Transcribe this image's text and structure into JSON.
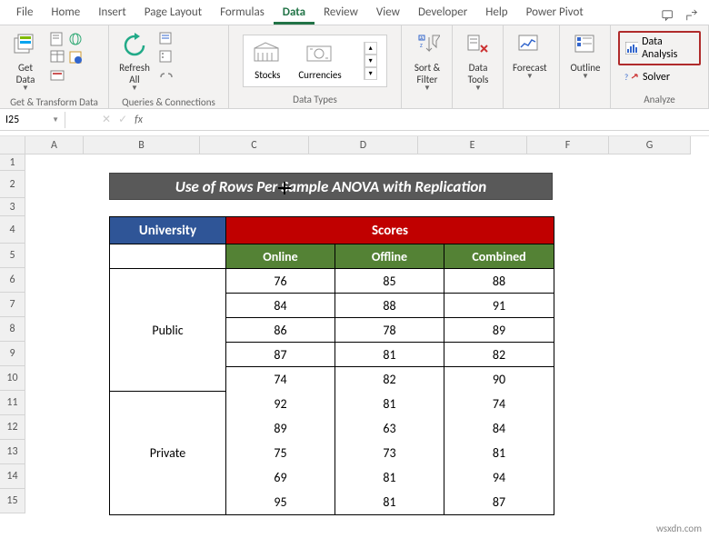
{
  "tabs": [
    "File",
    "Home",
    "Insert",
    "Page Layout",
    "Formulas",
    "Data",
    "Review",
    "View",
    "Developer",
    "Help",
    "Power Pivot"
  ],
  "active_tab": "Data",
  "ribbon": {
    "get_transform": {
      "get_data": "Get\nData",
      "label": "Get & Transform Data"
    },
    "queries": {
      "refresh": "Refresh\nAll",
      "label": "Queries & Connections"
    },
    "data_types": {
      "stocks": "Stocks",
      "currencies": "Currencies",
      "label": "Data Types"
    },
    "sort_filter": {
      "btn": "Sort &\nFilter",
      "label": ""
    },
    "data_tools": {
      "btn": "Data\nTools",
      "label": ""
    },
    "forecast": {
      "btn": "Forecast",
      "label": ""
    },
    "outline": {
      "btn": "Outline",
      "label": ""
    },
    "analyze": {
      "data_analysis": "Data Analysis",
      "solver": "Solver",
      "label": "Analyze"
    }
  },
  "name_box": "I25",
  "title_banner": "Use of Rows Per Sample ANOVA with Replication",
  "table": {
    "header_university": "University",
    "header_scores": "Scores",
    "sub_headers": [
      "Online",
      "Offline",
      "Combined"
    ],
    "groups": [
      {
        "name": "Public",
        "rows": [
          [
            76,
            85,
            88
          ],
          [
            84,
            88,
            91
          ],
          [
            86,
            78,
            89
          ],
          [
            87,
            81,
            82
          ],
          [
            74,
            82,
            90
          ]
        ]
      },
      {
        "name": "Private",
        "rows": [
          [
            92,
            81,
            74
          ],
          [
            89,
            63,
            84
          ],
          [
            75,
            73,
            81
          ],
          [
            69,
            81,
            94
          ],
          [
            95,
            81,
            87
          ]
        ]
      }
    ]
  },
  "col_heads": [
    "A",
    "B",
    "C",
    "D",
    "E",
    "F",
    "G"
  ],
  "row_heads": [
    "1",
    "2",
    "3",
    "4",
    "5",
    "6",
    "7",
    "8",
    "9",
    "10",
    "11",
    "12",
    "13",
    "14",
    "15"
  ],
  "watermark": "wsxdn.com"
}
